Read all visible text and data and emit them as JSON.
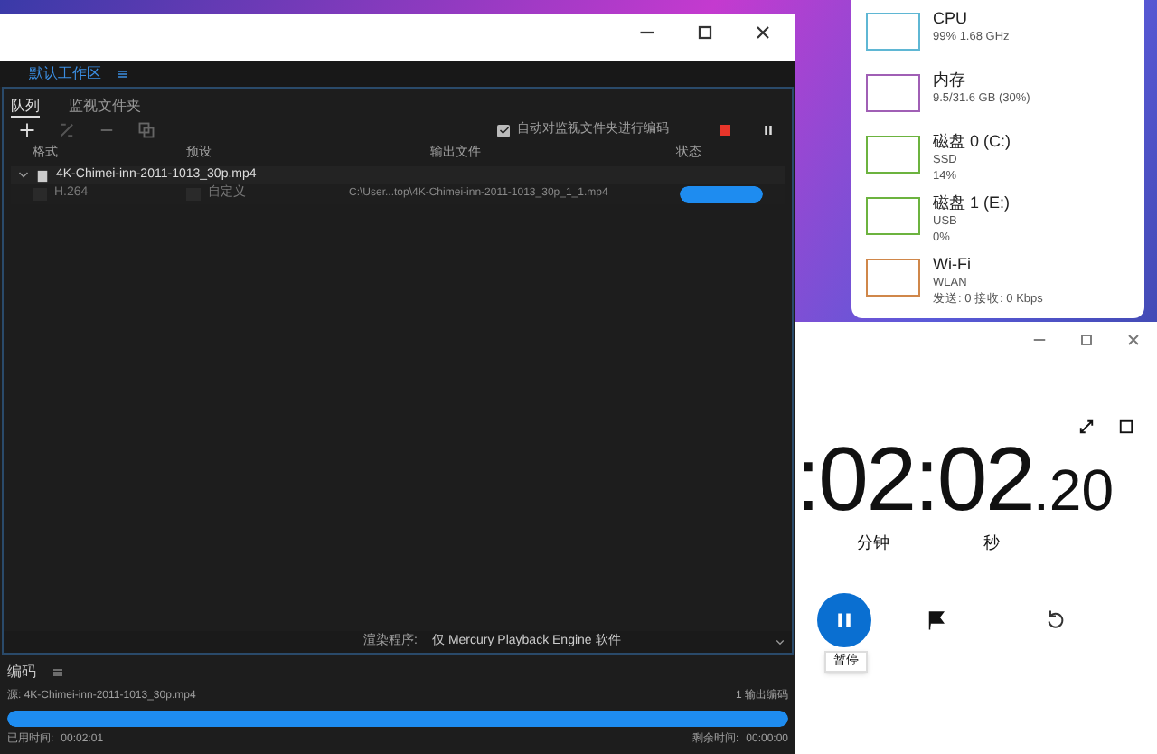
{
  "encoder": {
    "workspace_tab": "默认工作区",
    "panel_tabs": [
      {
        "label": "队列",
        "selected": true
      },
      {
        "label": "监视文件夹",
        "selected": false
      }
    ],
    "auto_encode": {
      "label": "自动对监视文件夹进行编码",
      "checked": true
    },
    "columns": [
      "格式",
      "预设",
      "输出文件",
      "状态"
    ],
    "queue": [
      {
        "name": "4K-Chimei-inn-2011-1013_30p.mp4",
        "expanded": true,
        "children": [
          {
            "format": "H.264",
            "preset": "自定义",
            "output": "C:\\User...top\\4K-Chimei-inn-2011-1013_30p_1_1.mp4",
            "level": 1
          }
        ]
      }
    ],
    "renderer": {
      "label": "渲染程序:",
      "value": "仅 Mercury Playback Engine 软件"
    },
    "encoding": {
      "title": "编码",
      "source": "源: 4K-Chimei-inn-2011-1013_30p.mp4",
      "outputs": "1 输出编码",
      "level": 1,
      "elapsed_label": "已用时间:",
      "elapsed": "00:02:01",
      "remaining_label": "剩余时间:",
      "remaining": "00:00:00"
    }
  },
  "performance": [
    {
      "name": "CPU",
      "lines": [
        "99%  1.68 GHz"
      ],
      "color": "#5fb7d4"
    },
    {
      "name": "内存",
      "lines": [
        "9.5/31.6 GB (30%)"
      ],
      "color": "#a05fb5"
    },
    {
      "name": "磁盘 0 (C:)",
      "lines": [
        "SSD",
        "14%"
      ],
      "color": "#6cb33f"
    },
    {
      "name": "磁盘 1 (E:)",
      "lines": [
        "USB",
        "0%"
      ],
      "color": "#6cb33f"
    },
    {
      "name": "Wi-Fi",
      "lines": [
        "WLAN",
        "发送: 0  接收: 0 Kbps"
      ],
      "color": "#d0874a"
    }
  ],
  "stopwatch": {
    "time": ":02:02",
    "fraction": ".20",
    "units": [
      "分钟",
      "秒"
    ],
    "tooltip": "暂停"
  }
}
